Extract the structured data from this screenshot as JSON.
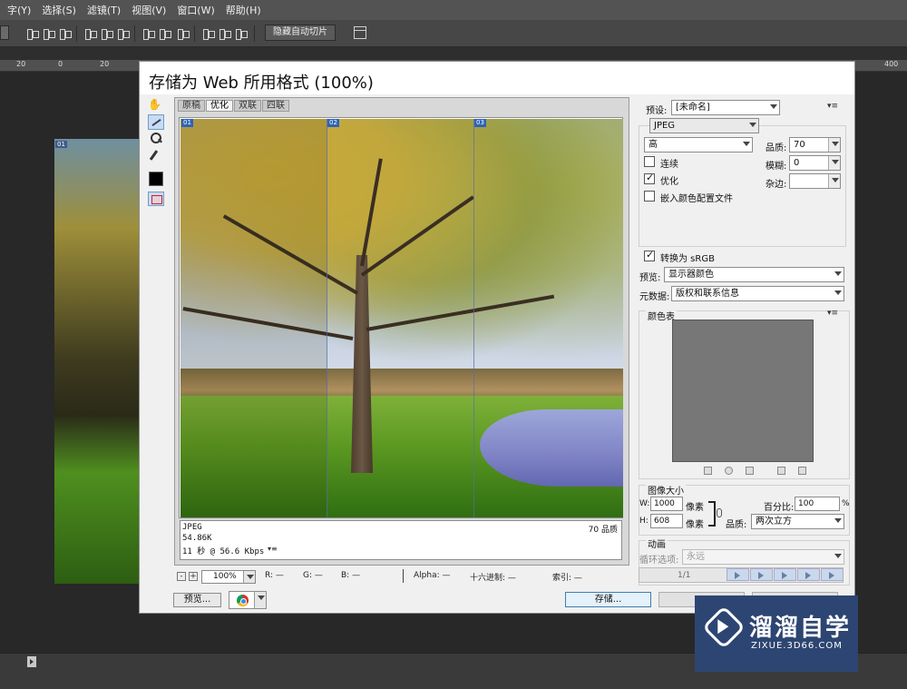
{
  "menubar": {
    "items": [
      "字(Y)",
      "选择(S)",
      "滤镜(T)",
      "视图(V)",
      "窗口(W)",
      "帮助(H)"
    ]
  },
  "optionsbar": {
    "hide_auto_slices": "隐藏自动切片"
  },
  "ruler": {
    "labels": [
      "20",
      "0",
      "20",
      "400"
    ]
  },
  "dialog": {
    "title": "存储为 Web 所用格式 (100%)",
    "tabs": [
      "原稿",
      "优化",
      "双联",
      "四联"
    ],
    "active_tab": "优化",
    "slice_labels": [
      "01",
      "02",
      "03"
    ],
    "info": {
      "format": "JPEG",
      "size": "54.86K",
      "time": "11 秒 @ 56.6 Kbps",
      "quality_text": "70 品质",
      "menu_glyph": "▾≡"
    },
    "zoom": {
      "value": "100%",
      "minus": "-",
      "plus": "+"
    },
    "readouts": {
      "r": "R: —",
      "g": "G: —",
      "b": "B: —",
      "alpha": "Alpha: —",
      "hex": "十六进制: —",
      "index": "索引: —"
    },
    "buttons": {
      "preview": "预览...",
      "save": "存储..."
    },
    "settings": {
      "preset_label": "预设:",
      "preset_value": "[未命名]",
      "format_value": "JPEG",
      "compression_value": "高",
      "quality_label": "品质:",
      "quality_value": "70",
      "blur_label": "模糊:",
      "blur_value": "0",
      "matte_label": "杂边:",
      "progressive_label": "连续",
      "progressive_checked": false,
      "optimized_label": "优化",
      "optimized_checked": true,
      "embed_profile_label": "嵌入颜色配置文件",
      "embed_profile_checked": false,
      "convert_srgb_label": "转换为 sRGB",
      "convert_srgb_checked": true,
      "preview_label": "预览:",
      "preview_value": "显示器颜色",
      "metadata_label": "元数据:",
      "metadata_value": "版权和联系信息",
      "color_table_label": "颜色表",
      "image_size_label": "图像大小",
      "width_label": "W:",
      "width_value": "1000",
      "height_label": "H:",
      "height_value": "608",
      "unit_pixels": "像素",
      "percent_label": "百分比:",
      "percent_value": "100",
      "percent_sign": "%",
      "quality_resample_label": "品质:",
      "quality_resample_value": "两次立方",
      "animation_label": "动画",
      "loop_label": "循环选项:",
      "loop_value": "永远",
      "frame_counter": "1/1",
      "panel_menu_glyph": "▾≡"
    }
  },
  "watermark": {
    "title": "溜溜自学",
    "url": "ZIXUE.3D66.COM"
  },
  "colors": {
    "workspace": "#282828",
    "dialog_bg": "#f0f0f0",
    "accent": "#2f63b6",
    "watermark_bg": "#2d4572"
  }
}
